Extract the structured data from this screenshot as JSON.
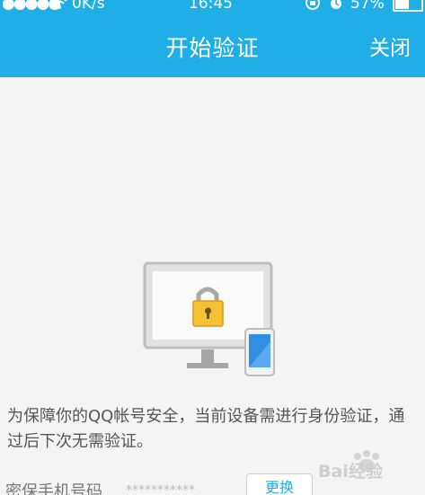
{
  "status_bar": {
    "signal": "●●●●●",
    "network_speed": "0K/s",
    "time": "16:45",
    "battery": "57%",
    "battery_level": 0.57
  },
  "header": {
    "title": "开始验证",
    "close_label": "关闭",
    "background_color": "#1faee6"
  },
  "illustration": {
    "icons": [
      "monitor-icon",
      "lock-icon",
      "phone-icon"
    ]
  },
  "notice": "为保障你的QQ帐号安全，当前设备需进行身份验证，通过后下次无需验证。",
  "phone_row": {
    "label": "密保手机号码",
    "value": "***********",
    "change_label": "更换"
  },
  "watermark": {
    "text": "Bai经验"
  }
}
